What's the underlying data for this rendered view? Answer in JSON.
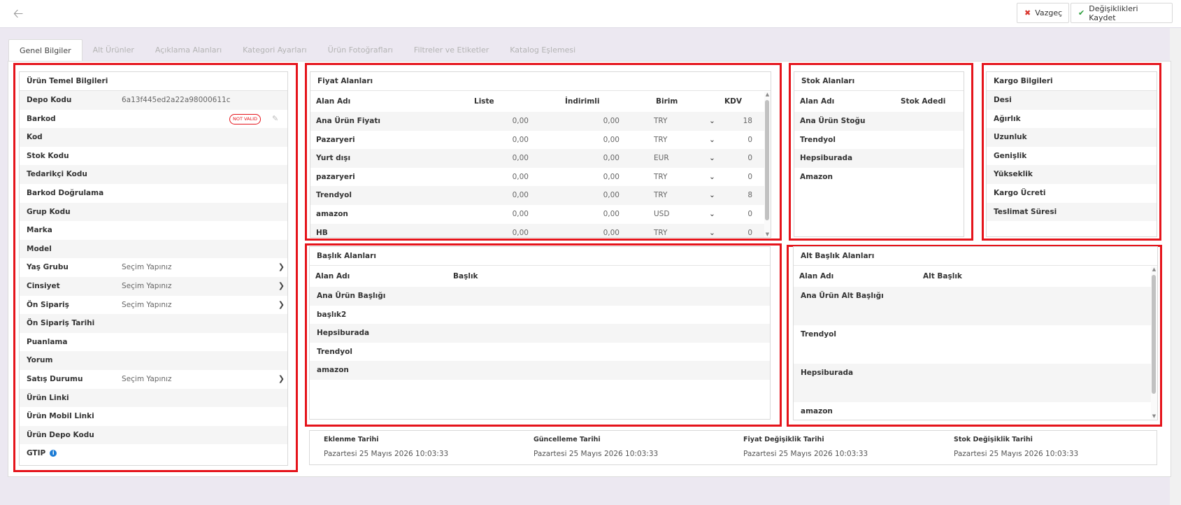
{
  "toolbar": {
    "cancel_label": "Vazgeç",
    "save_label": "Değişiklikleri Kaydet"
  },
  "tabs": [
    {
      "label": "Genel Bilgiler",
      "active": true
    },
    {
      "label": "Alt Ürünler"
    },
    {
      "label": "Açıklama Alanları"
    },
    {
      "label": "Kategori Ayarları"
    },
    {
      "label": "Ürün Fotoğrafları"
    },
    {
      "label": "Filtreler ve Etiketler"
    },
    {
      "label": "Katalog Eşlemesi"
    }
  ],
  "basic": {
    "title": "Ürün Temel Bilgileri",
    "not_valid": "NOT VALID",
    "rows": [
      {
        "label": "Depo Kodu",
        "value": "6a13f445ed2a22a98000611c"
      },
      {
        "label": "Barkod",
        "value": ""
      },
      {
        "label": "Kod",
        "value": ""
      },
      {
        "label": "Stok Kodu",
        "value": ""
      },
      {
        "label": "Tedarikçi Kodu",
        "value": ""
      },
      {
        "label": "Barkod Doğrulama",
        "value": ""
      },
      {
        "label": "Grup Kodu",
        "value": ""
      },
      {
        "label": "Marka",
        "value": ""
      },
      {
        "label": "Model",
        "value": ""
      },
      {
        "label": "Yaş Grubu",
        "value": "Seçim Yapınız"
      },
      {
        "label": "Cinsiyet",
        "value": "Seçim Yapınız"
      },
      {
        "label": "Ön Sipariş",
        "value": "Seçim Yapınız"
      },
      {
        "label": "Ön Sipariş Tarihi",
        "value": ""
      },
      {
        "label": "Puanlama",
        "value": ""
      },
      {
        "label": "Yorum",
        "value": ""
      },
      {
        "label": "Satış Durumu",
        "value": "Seçim Yapınız"
      },
      {
        "label": "Ürün Linki",
        "value": ""
      },
      {
        "label": "Ürün Mobil Linki",
        "value": ""
      },
      {
        "label": "Ürün Depo Kodu",
        "value": ""
      },
      {
        "label": "GTIP",
        "value": ""
      }
    ]
  },
  "price": {
    "title": "Fiyat Alanları",
    "headers": [
      "Alan Adı",
      "Liste",
      "İndirimli",
      "Birim",
      "KDV"
    ],
    "rows": [
      {
        "name": "Ana Ürün Fiyatı",
        "list": "0,00",
        "discount": "0,00",
        "unit": "TRY",
        "vat": "18"
      },
      {
        "name": "Pazaryeri",
        "list": "0,00",
        "discount": "0,00",
        "unit": "TRY",
        "vat": "0"
      },
      {
        "name": "Yurt dışı",
        "list": "0,00",
        "discount": "0,00",
        "unit": "EUR",
        "vat": "0"
      },
      {
        "name": "pazaryeri",
        "list": "0,00",
        "discount": "0,00",
        "unit": "TRY",
        "vat": "0"
      },
      {
        "name": "Trendyol",
        "list": "0,00",
        "discount": "0,00",
        "unit": "TRY",
        "vat": "8"
      },
      {
        "name": "amazon",
        "list": "0,00",
        "discount": "0,00",
        "unit": "USD",
        "vat": "0"
      },
      {
        "name": "HB",
        "list": "0,00",
        "discount": "0,00",
        "unit": "TRY",
        "vat": "0"
      }
    ]
  },
  "stock": {
    "title": "Stok Alanları",
    "headers": [
      "Alan Adı",
      "Stok Adedi"
    ],
    "rows": [
      "Ana Ürün Stoğu",
      "Trendyol",
      "Hepsiburada",
      "Amazon"
    ]
  },
  "cargo": {
    "title": "Kargo Bilgileri",
    "rows": [
      "Desi",
      "Ağırlık",
      "Uzunluk",
      "Genişlik",
      "Yükseklik",
      "Kargo Ücreti",
      "Teslimat Süresi"
    ]
  },
  "titles": {
    "title": "Başlık Alanları",
    "headers": [
      "Alan Adı",
      "Başlık"
    ],
    "rows": [
      "Ana Ürün Başlığı",
      "başlık2",
      "Hepsiburada",
      "Trendyol",
      "amazon"
    ]
  },
  "subtitles": {
    "title": "Alt Başlık Alanları",
    "headers": [
      "Alan Adı",
      "Alt Başlık"
    ],
    "rows": [
      "Ana Ürün Alt Başlığı",
      "Trendyol",
      "Hepsiburada",
      "amazon"
    ]
  },
  "dates": [
    {
      "label": "Eklenme Tarihi",
      "value": "Pazartesi 25 Mayıs 2026 10:03:33"
    },
    {
      "label": "Güncelleme Tarihi",
      "value": "Pazartesi 25 Mayıs 2026 10:03:33"
    },
    {
      "label": "Fiyat Değişiklik Tarihi",
      "value": "Pazartesi 25 Mayıs 2026 10:03:33"
    },
    {
      "label": "Stok Değişiklik Tarihi",
      "value": "Pazartesi 25 Mayıs 2026 10:03:33"
    }
  ],
  "colors": {
    "highlight": "#e5141b",
    "cancel": "#d9342b",
    "save": "#2a9d3a",
    "info": "#1c7cd5"
  }
}
